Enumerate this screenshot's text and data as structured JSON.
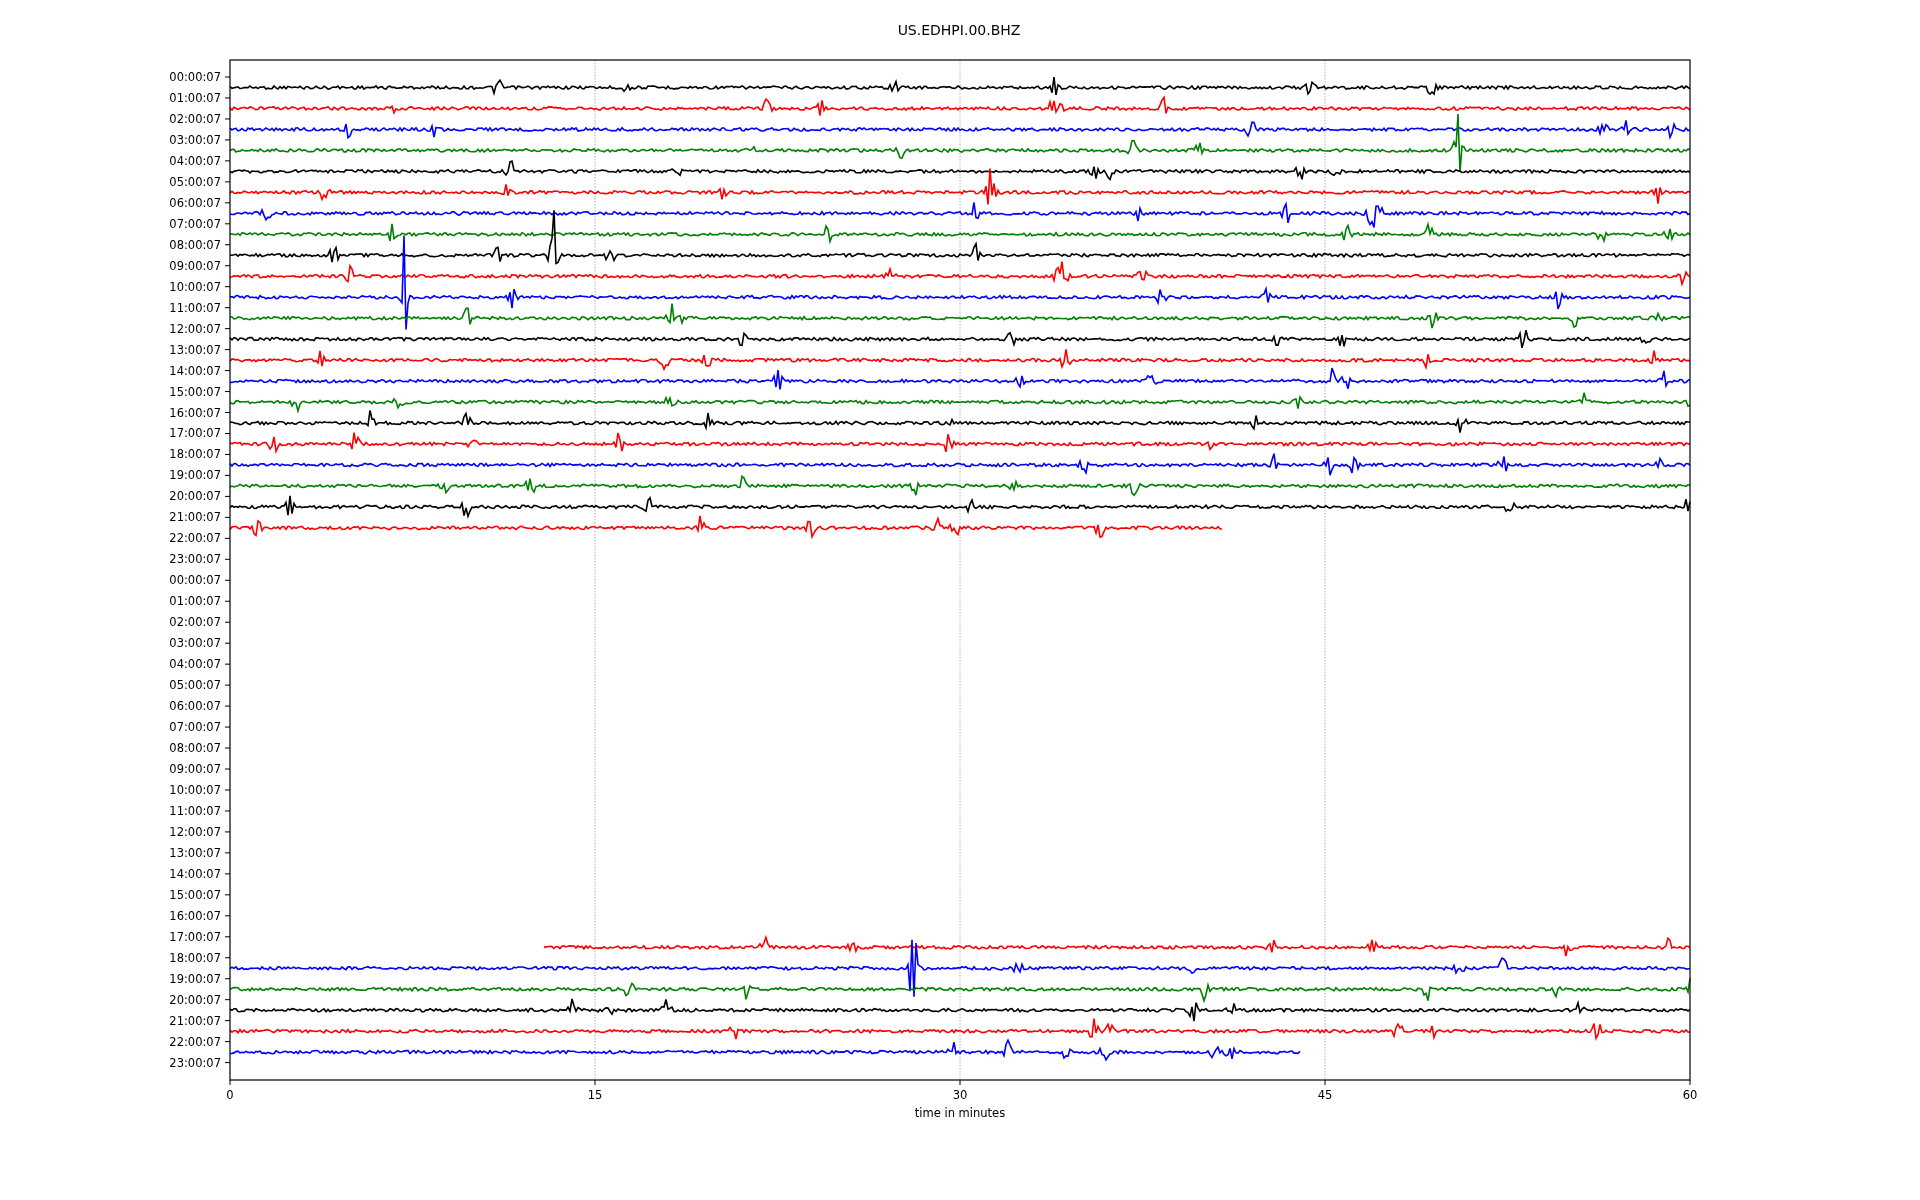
{
  "plot": {
    "title": "US.EDHPI.00.BHZ",
    "xlabel": "time in minutes",
    "xticks": [
      "0",
      "15",
      "30",
      "45",
      "60"
    ],
    "rows": [
      {
        "label": "00:00:07",
        "trace": {
          "kind": "full",
          "color": "#000000"
        }
      },
      {
        "label": "01:00:07",
        "trace": {
          "kind": "full",
          "color": "#ff0000"
        }
      },
      {
        "label": "02:00:07",
        "trace": {
          "kind": "full",
          "color": "#0000ff"
        }
      },
      {
        "label": "03:00:07",
        "trace": {
          "kind": "full",
          "color": "#008000"
        }
      },
      {
        "label": "04:00:07",
        "trace": {
          "kind": "full",
          "color": "#000000"
        }
      },
      {
        "label": "05:00:07",
        "trace": {
          "kind": "full",
          "color": "#ff0000"
        }
      },
      {
        "label": "06:00:07",
        "trace": {
          "kind": "full",
          "color": "#0000ff"
        }
      },
      {
        "label": "07:00:07",
        "trace": {
          "kind": "full",
          "color": "#008000"
        }
      },
      {
        "label": "08:00:07",
        "trace": {
          "kind": "full",
          "color": "#000000"
        }
      },
      {
        "label": "09:00:07",
        "trace": {
          "kind": "full",
          "color": "#ff0000"
        }
      },
      {
        "label": "10:00:07",
        "trace": {
          "kind": "full",
          "color": "#0000ff"
        }
      },
      {
        "label": "11:00:07",
        "trace": {
          "kind": "full",
          "color": "#008000"
        }
      },
      {
        "label": "12:00:07",
        "trace": {
          "kind": "full",
          "color": "#000000"
        }
      },
      {
        "label": "13:00:07",
        "trace": {
          "kind": "full",
          "color": "#ff0000"
        }
      },
      {
        "label": "14:00:07",
        "trace": {
          "kind": "full",
          "color": "#0000ff"
        }
      },
      {
        "label": "15:00:07",
        "trace": {
          "kind": "full",
          "color": "#008000"
        }
      },
      {
        "label": "16:00:07",
        "trace": {
          "kind": "full",
          "color": "#000000"
        }
      },
      {
        "label": "17:00:07",
        "trace": {
          "kind": "full",
          "color": "#ff0000"
        }
      },
      {
        "label": "18:00:07",
        "trace": {
          "kind": "full",
          "color": "#0000ff"
        }
      },
      {
        "label": "19:00:07",
        "trace": {
          "kind": "full",
          "color": "#008000"
        }
      },
      {
        "label": "20:00:07",
        "trace": {
          "kind": "full",
          "color": "#000000"
        }
      },
      {
        "label": "21:00:07",
        "trace": {
          "kind": "ends_early",
          "color": "#ff0000",
          "level": 0.68
        }
      },
      {
        "label": "22:00:07"
      },
      {
        "label": "23:00:07"
      },
      {
        "label": "00:00:07"
      },
      {
        "label": "01:00:07"
      },
      {
        "label": "02:00:07"
      },
      {
        "label": "03:00:07"
      },
      {
        "label": "04:00:07"
      },
      {
        "label": "05:00:07"
      },
      {
        "label": "06:00:07"
      },
      {
        "label": "07:00:07"
      },
      {
        "label": "08:00:07"
      },
      {
        "label": "09:00:07"
      },
      {
        "label": "10:00:07"
      },
      {
        "label": "11:00:07"
      },
      {
        "label": "12:00:07"
      },
      {
        "label": "13:00:07"
      },
      {
        "label": "14:00:07"
      },
      {
        "label": "15:00:07"
      },
      {
        "label": "16:00:07"
      },
      {
        "label": "17:00:07",
        "trace": {
          "kind": "starts_late",
          "color": "#ff0000",
          "level": 0.785
        }
      },
      {
        "label": "18:00:07",
        "trace": {
          "kind": "full",
          "color": "#0000ff"
        }
      },
      {
        "label": "19:00:07",
        "trace": {
          "kind": "full",
          "color": "#008000"
        }
      },
      {
        "label": "20:00:07",
        "trace": {
          "kind": "full",
          "color": "#000000"
        }
      },
      {
        "label": "21:00:07",
        "trace": {
          "kind": "full",
          "color": "#ff0000"
        }
      },
      {
        "label": "22:00:07",
        "trace": {
          "kind": "ends_early",
          "color": "#0000ff",
          "level": 0.733
        }
      },
      {
        "label": "23:00:07"
      }
    ]
  }
}
